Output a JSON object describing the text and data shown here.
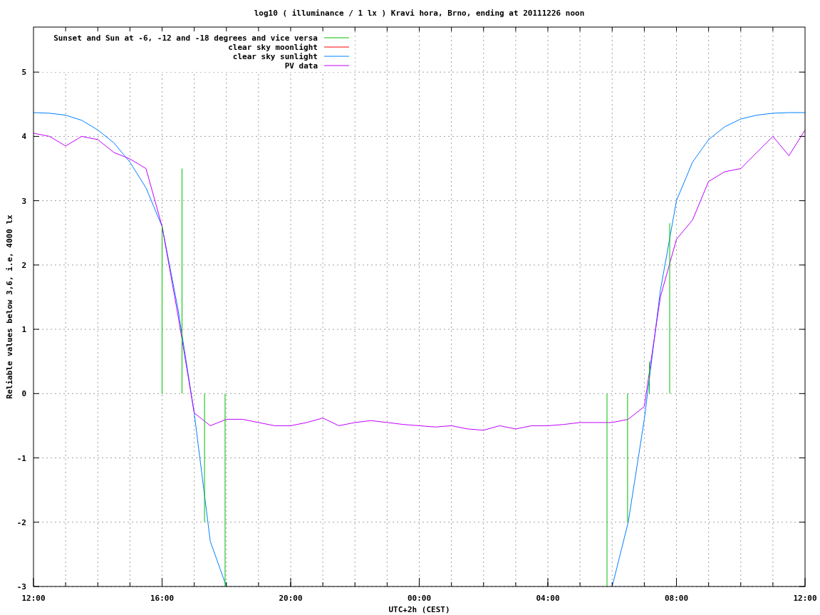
{
  "chart_data": {
    "type": "line",
    "title": "log10 ( illuminance / 1 lx ) Kravi hora, Brno, ending at 20111226 noon",
    "xlabel": "UTC+2h (CEST)",
    "ylabel": "Reliable values below 3,6, i.e, 4000 lx",
    "ylim": [
      -3,
      5.7
    ],
    "yticks": [
      -3,
      -2,
      -1,
      0,
      1,
      2,
      3,
      4,
      5
    ],
    "categories": [
      "12:00",
      null,
      null,
      null,
      null,
      null,
      null,
      null,
      "16:00",
      null,
      null,
      null,
      null,
      null,
      null,
      null,
      "20:00",
      null,
      null,
      null,
      null,
      null,
      null,
      null,
      "00:00",
      null,
      null,
      null,
      null,
      null,
      null,
      null,
      "04:00",
      null,
      null,
      null,
      null,
      null,
      null,
      null,
      "08:00",
      null,
      null,
      null,
      null,
      null,
      null,
      null,
      "12:00"
    ],
    "series": [
      {
        "name": "Sunset and Sun at -6, -12 and -18 degrees and vice versa",
        "color": "#00c000",
        "values": [
          null,
          null,
          null,
          null,
          null,
          null,
          null,
          null,
          null,
          null,
          null,
          null,
          null,
          null,
          null,
          null,
          null,
          null,
          null,
          null,
          null,
          null,
          null,
          null,
          null,
          null,
          null,
          null,
          null,
          null,
          null,
          null,
          null,
          null,
          null,
          null,
          null,
          null,
          null,
          null,
          null,
          null,
          null,
          null,
          null,
          null,
          null,
          null,
          null
        ]
      },
      {
        "name": "clear sky moonlight",
        "color": "#ff0000",
        "values": [
          null,
          null,
          null,
          null,
          null,
          null,
          null,
          null,
          null,
          null,
          null,
          null,
          null,
          null,
          null,
          null,
          null,
          null,
          null,
          null,
          null,
          null,
          null,
          null,
          null,
          null,
          null,
          null,
          null,
          null,
          null,
          null,
          null,
          null,
          null,
          null,
          null,
          null,
          null,
          null,
          null,
          null,
          null,
          null,
          null,
          null,
          null,
          null,
          null
        ]
      },
      {
        "name": "clear sky sunlight",
        "color": "#0080ff",
        "values": [
          4.37,
          4.36,
          4.33,
          4.25,
          4.1,
          3.9,
          3.6,
          3.2,
          2.6,
          1.3,
          -0.3,
          -2.3,
          -3,
          null,
          null,
          null,
          null,
          null,
          null,
          null,
          null,
          null,
          null,
          null,
          null,
          null,
          null,
          null,
          null,
          null,
          null,
          null,
          null,
          null,
          null,
          null,
          -3,
          -2.0,
          -0.4,
          1.6,
          3.0,
          3.6,
          3.95,
          4.15,
          4.27,
          4.33,
          4.36,
          4.37,
          4.37
        ]
      },
      {
        "name": "PV data",
        "color": "#c000ff",
        "values": [
          4.05,
          4.0,
          3.85,
          4.0,
          3.95,
          3.75,
          3.65,
          3.5,
          2.6,
          1.2,
          -0.3,
          -0.5,
          -0.4,
          -0.4,
          -0.45,
          -0.5,
          -0.5,
          -0.45,
          -0.38,
          -0.5,
          -0.45,
          -0.42,
          -0.45,
          -0.48,
          -0.5,
          -0.52,
          -0.5,
          -0.55,
          -0.57,
          -0.5,
          -0.55,
          -0.5,
          -0.5,
          -0.48,
          -0.45,
          -0.45,
          -0.45,
          -0.4,
          -0.2,
          1.5,
          2.4,
          2.7,
          3.3,
          3.45,
          3.5,
          3.75,
          4.0,
          3.7,
          4.1
        ]
      }
    ],
    "grid": true,
    "legend": true
  }
}
